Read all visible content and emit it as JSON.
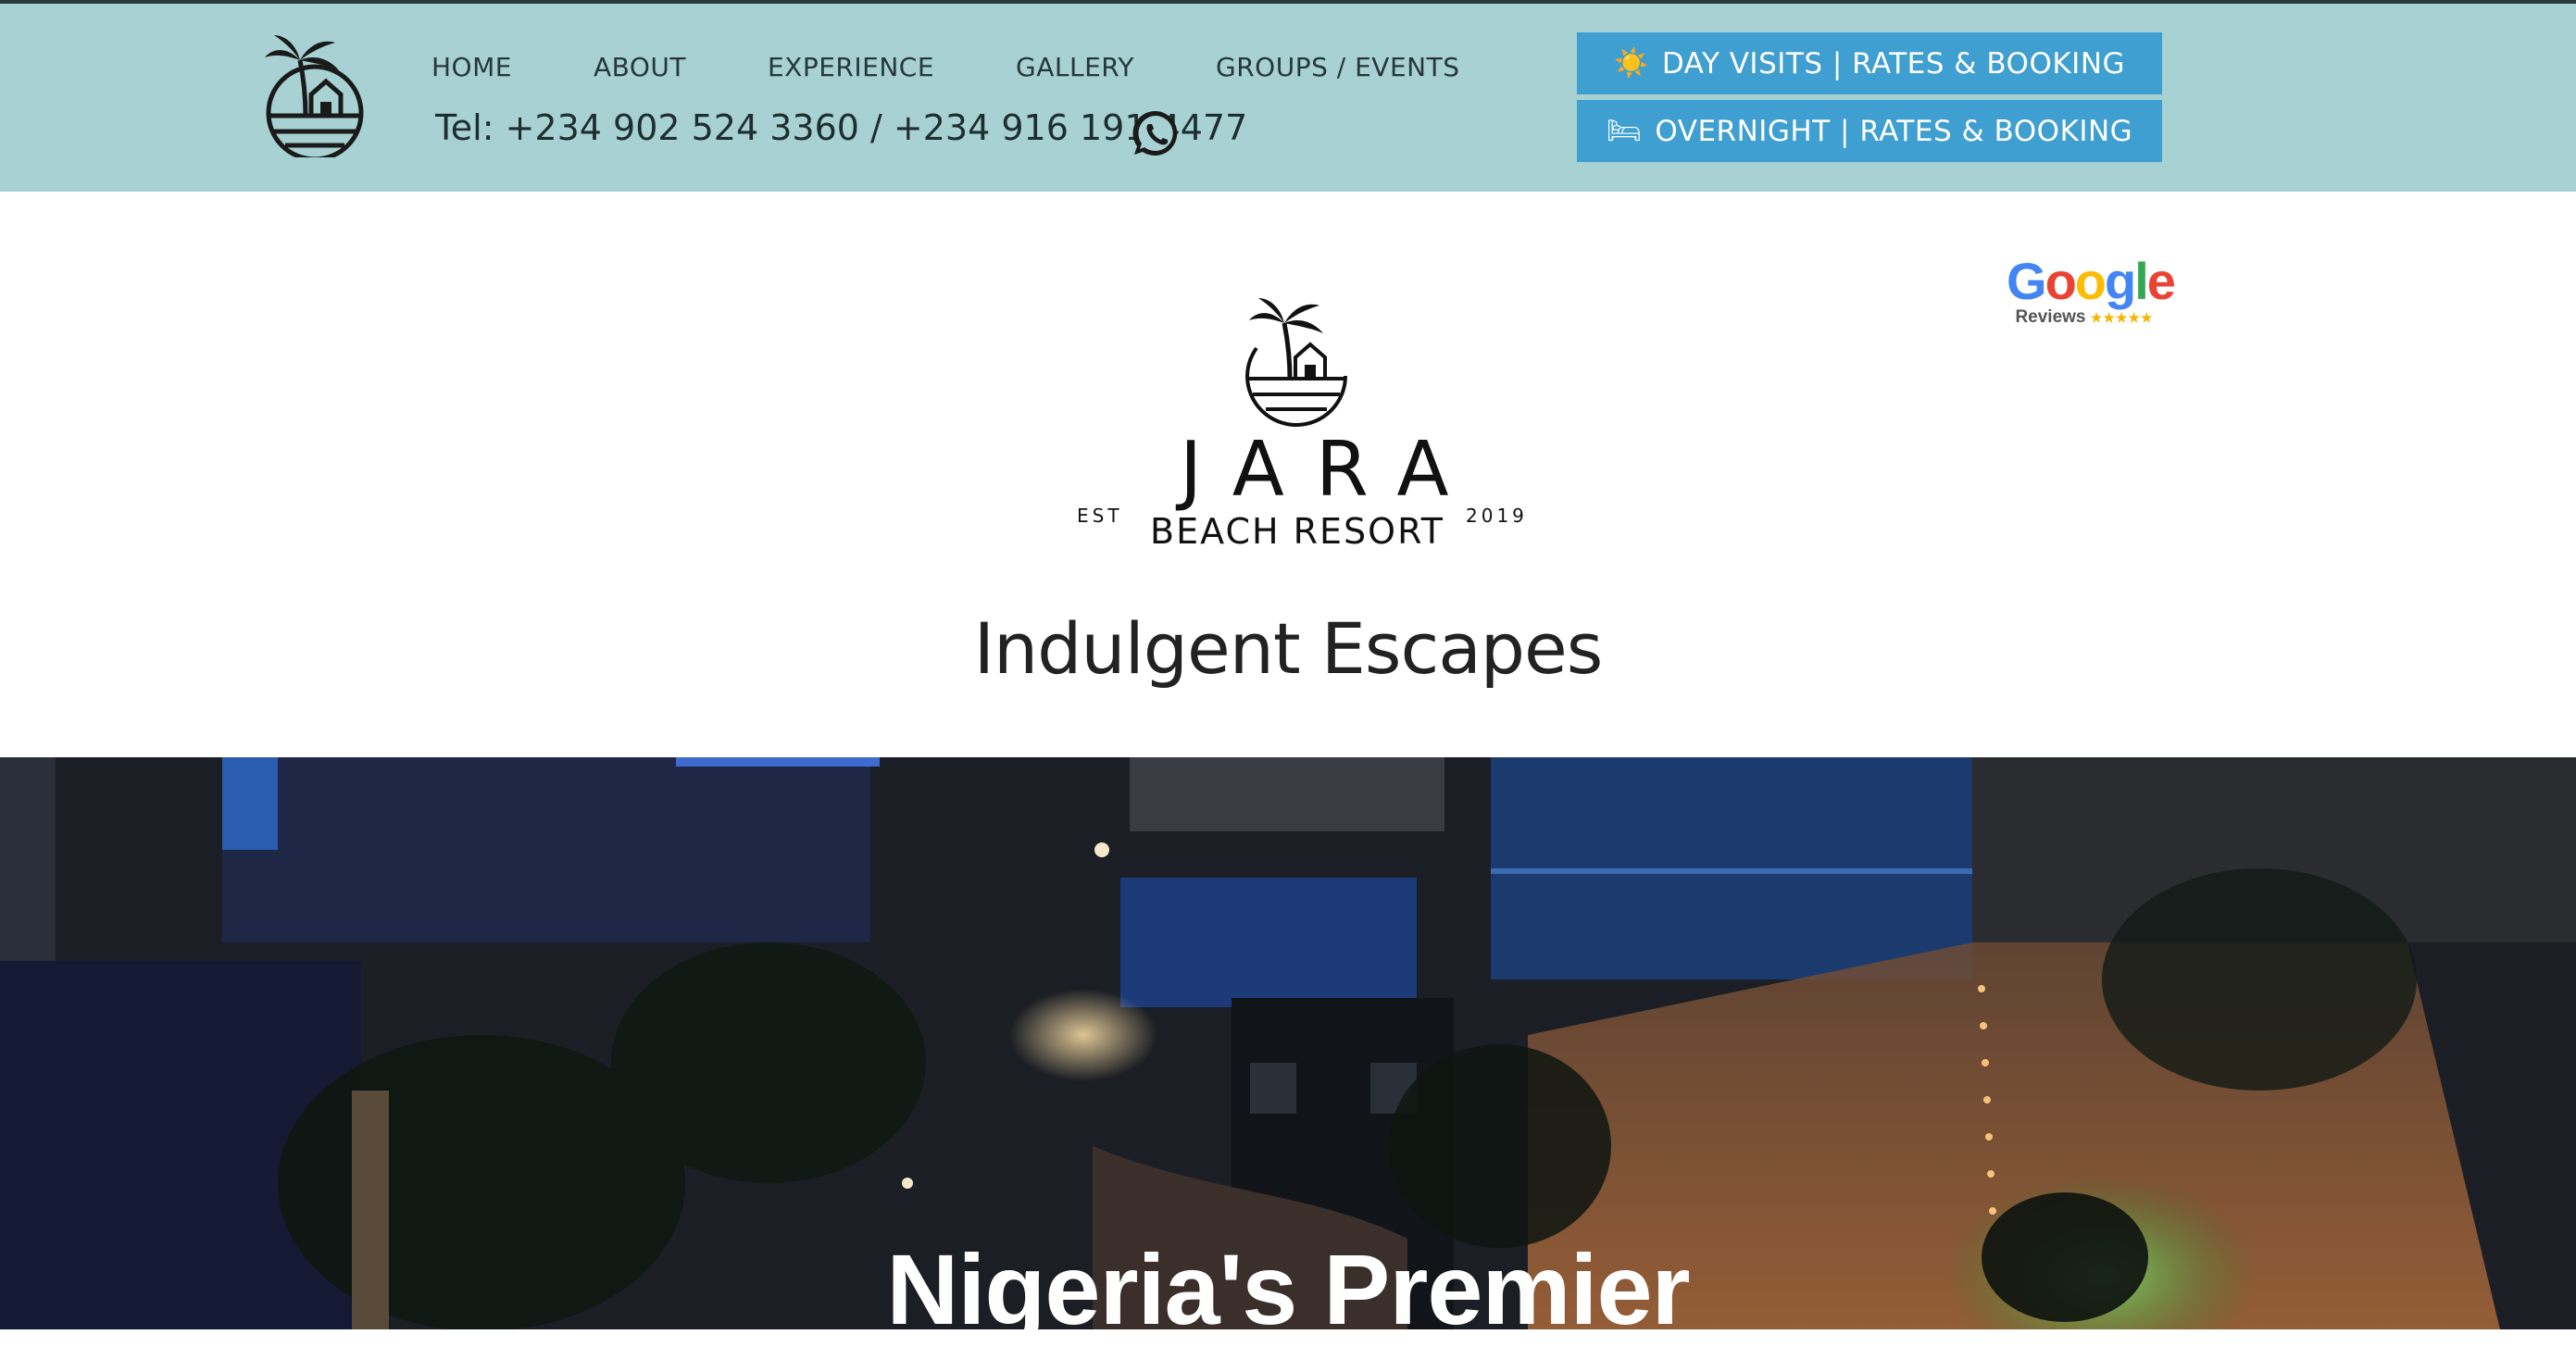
{
  "nav": {
    "items": [
      {
        "label": "HOME"
      },
      {
        "label": "ABOUT"
      },
      {
        "label": "EXPERIENCE"
      },
      {
        "label": "GALLERY"
      },
      {
        "label": "GROUPS / EVENTS"
      }
    ]
  },
  "header": {
    "phone": "Tel: +234 902 524 3360 / +234 916 191 4477",
    "day_visits_icon": "☀️",
    "day_visits_label": "DAY VISITS | RATES & BOOKING",
    "overnight_icon": "🛏",
    "overnight_label": "OVERNIGHT | RATES & BOOKING"
  },
  "google": {
    "letters": [
      "G",
      "o",
      "o",
      "g",
      "l",
      "e"
    ],
    "reviews": "Reviews",
    "stars": "★★★★★"
  },
  "brand": {
    "name": "JARA",
    "subtitle": "BEACH RESORT",
    "est": "EST",
    "year": "2019"
  },
  "tagline": "Indulgent Escapes",
  "hero": {
    "title": "Nigeria's Premier"
  },
  "colors": {
    "header_bg": "#a7d1d2",
    "button_bg": "#3f9fd0",
    "google_blue": "#4285f4",
    "google_red": "#ea4335",
    "google_yellow": "#fbbc05",
    "google_green": "#34a853"
  },
  "icons": {
    "header_logo": "palm-house-logo-icon",
    "whatsapp": "whatsapp-icon",
    "brand_logo": "palm-house-logo-icon"
  }
}
